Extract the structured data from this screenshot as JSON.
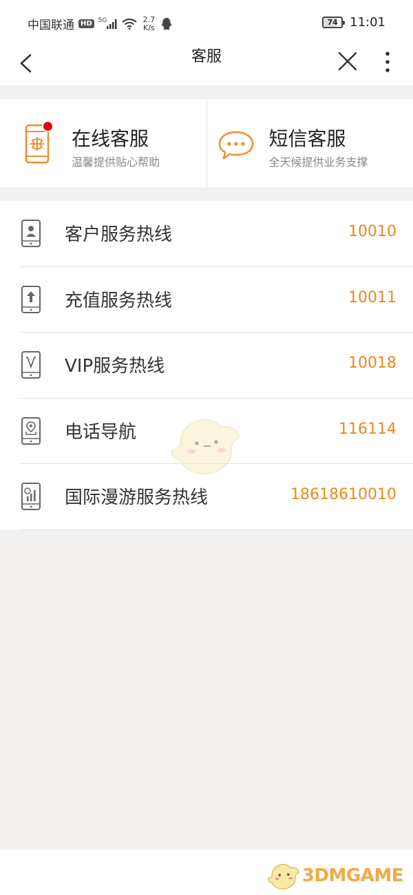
{
  "status_bar": {
    "carrier": "中国联通",
    "hd": "HD",
    "network": "5G",
    "speed_value": "2.7",
    "speed_unit": "K/s",
    "battery": "74",
    "battery_level": 0.74,
    "time": "11:01"
  },
  "nav": {
    "title": "客服",
    "icons": [
      "back-icon",
      "close-icon",
      "more-icon"
    ]
  },
  "services": [
    {
      "title": "在线客服",
      "subtitle": "温馨提供贴心帮助",
      "icon": "phone-unicom-icon",
      "has_badge": true
    },
    {
      "title": "短信客服",
      "subtitle": "全天候提供业务支撑",
      "icon": "chat-bubble-icon",
      "has_badge": false
    }
  ],
  "hotlines": [
    {
      "label": "客户服务热线",
      "number": "10010",
      "icon": "phone-person-icon"
    },
    {
      "label": "充值服务热线",
      "number": "10011",
      "icon": "phone-upload-icon"
    },
    {
      "label": "VIP服务热线",
      "number": "10018",
      "icon": "phone-vip-icon"
    },
    {
      "label": "电话导航",
      "number": "116114",
      "icon": "phone-location-icon"
    },
    {
      "label": "国际漫游服务热线",
      "number": "18618610010",
      "icon": "phone-globe-icon"
    }
  ],
  "watermark": {
    "text": "3DMGAME"
  },
  "colors": {
    "accent": "#e8891a",
    "badge": "#e60012",
    "background": "#f2f1f0",
    "divider": "#e2e2e2"
  }
}
